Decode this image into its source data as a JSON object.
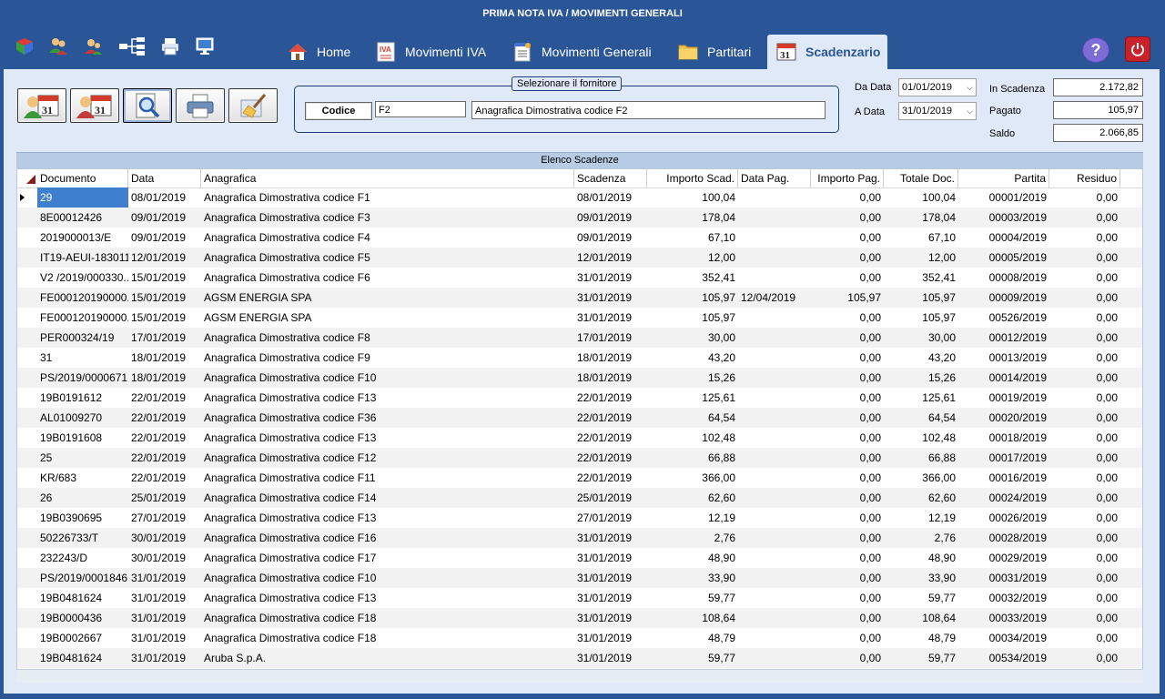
{
  "window": {
    "title": "PRIMA NOTA IVA / MOVIMENTI GENERALI"
  },
  "toolbar_icons": [
    "cube-icon",
    "users-icon",
    "user-icon",
    "tree-icon",
    "printer-icon",
    "monitor-icon"
  ],
  "tabs": [
    {
      "label": "Home",
      "icon": "home-icon"
    },
    {
      "label": "Movimenti IVA",
      "icon": "iva-icon"
    },
    {
      "label": "Movimenti Generali",
      "icon": "notepad-icon"
    },
    {
      "label": "Partitari",
      "icon": "folder-icon"
    },
    {
      "label": "Scadenzario",
      "icon": "calendar-icon",
      "active": true
    }
  ],
  "filter": {
    "legend": "Selezionare il fornitore",
    "codice_button": "Codice",
    "codice_value": "F2",
    "anagrafica_value": "Anagrafica Dimostrativa codice F2"
  },
  "dates": {
    "da_label": "Da Data",
    "da_value": "01/01/2019",
    "a_label": "A Data",
    "a_value": "31/01/2019"
  },
  "summary": {
    "in_scadenza_label": "In Scadenza",
    "in_scadenza_value": "2.172,82",
    "pagato_label": "Pagato",
    "pagato_value": "105,97",
    "saldo_label": "Saldo",
    "saldo_value": "2.066,85"
  },
  "grid": {
    "caption": "Elenco Scadenze",
    "columns": [
      "Documento",
      "Data",
      "Anagrafica",
      "Scadenza",
      "Importo Scad.",
      "Data Pag.",
      "Importo Pag.",
      "Totale Doc.",
      "Partita",
      "Residuo"
    ],
    "rows": [
      [
        "29",
        "08/01/2019",
        "Anagrafica Dimostrativa codice F1",
        "08/01/2019",
        "100,04",
        "",
        "0,00",
        "100,04",
        "00001/2019",
        "0,00"
      ],
      [
        "8E00012426",
        "09/01/2019",
        "Anagrafica Dimostrativa codice F3",
        "09/01/2019",
        "178,04",
        "",
        "0,00",
        "178,04",
        "00003/2019",
        "0,00"
      ],
      [
        "2019000013/E",
        "09/01/2019",
        "Anagrafica Dimostrativa codice F4",
        "09/01/2019",
        "67,10",
        "",
        "0,00",
        "67,10",
        "00004/2019",
        "0,00"
      ],
      [
        "IT19-AEUI-183011",
        "12/01/2019",
        "Anagrafica Dimostrativa codice F5",
        "12/01/2019",
        "12,00",
        "",
        "0,00",
        "12,00",
        "00005/2019",
        "0,00"
      ],
      [
        "V2 /2019/000330...",
        "15/01/2019",
        "Anagrafica Dimostrativa codice F6",
        "31/01/2019",
        "352,41",
        "",
        "0,00",
        "352,41",
        "00008/2019",
        "0,00"
      ],
      [
        "FE000120190000...",
        "15/01/2019",
        "AGSM ENERGIA SPA",
        "31/01/2019",
        "105,97",
        "12/04/2019",
        "105,97",
        "105,97",
        "00009/2019",
        "0,00"
      ],
      [
        "FE000120190000...",
        "15/01/2019",
        "AGSM ENERGIA SPA",
        "31/01/2019",
        "105,97",
        "",
        "0,00",
        "105,97",
        "00526/2019",
        "0,00"
      ],
      [
        "PER000324/19",
        "17/01/2019",
        "Anagrafica Dimostrativa codice F8",
        "17/01/2019",
        "30,00",
        "",
        "0,00",
        "30,00",
        "00012/2019",
        "0,00"
      ],
      [
        "31",
        "18/01/2019",
        "Anagrafica Dimostrativa codice F9",
        "18/01/2019",
        "43,20",
        "",
        "0,00",
        "43,20",
        "00013/2019",
        "0,00"
      ],
      [
        "PS/2019/0000671",
        "18/01/2019",
        "Anagrafica Dimostrativa codice F10",
        "18/01/2019",
        "15,26",
        "",
        "0,00",
        "15,26",
        "00014/2019",
        "0,00"
      ],
      [
        "19B0191612",
        "22/01/2019",
        "Anagrafica Dimostrativa codice F13",
        "22/01/2019",
        "125,61",
        "",
        "0,00",
        "125,61",
        "00019/2019",
        "0,00"
      ],
      [
        "AL01009270",
        "22/01/2019",
        "Anagrafica Dimostrativa codice F36",
        "22/01/2019",
        "64,54",
        "",
        "0,00",
        "64,54",
        "00020/2019",
        "0,00"
      ],
      [
        "19B0191608",
        "22/01/2019",
        "Anagrafica Dimostrativa codice F13",
        "22/01/2019",
        "102,48",
        "",
        "0,00",
        "102,48",
        "00018/2019",
        "0,00"
      ],
      [
        "25",
        "22/01/2019",
        "Anagrafica Dimostrativa codice F12",
        "22/01/2019",
        "66,88",
        "",
        "0,00",
        "66,88",
        "00017/2019",
        "0,00"
      ],
      [
        "KR/683",
        "22/01/2019",
        "Anagrafica Dimostrativa codice F11",
        "22/01/2019",
        "366,00",
        "",
        "0,00",
        "366,00",
        "00016/2019",
        "0,00"
      ],
      [
        "26",
        "25/01/2019",
        "Anagrafica Dimostrativa codice F14",
        "25/01/2019",
        "62,60",
        "",
        "0,00",
        "62,60",
        "00024/2019",
        "0,00"
      ],
      [
        "19B0390695",
        "27/01/2019",
        "Anagrafica Dimostrativa codice F13",
        "27/01/2019",
        "12,19",
        "",
        "0,00",
        "12,19",
        "00026/2019",
        "0,00"
      ],
      [
        "50226733/T",
        "30/01/2019",
        "Anagrafica Dimostrativa codice F16",
        "31/01/2019",
        "2,76",
        "",
        "0,00",
        "2,76",
        "00028/2019",
        "0,00"
      ],
      [
        "232243/D",
        "30/01/2019",
        "Anagrafica Dimostrativa codice F17",
        "31/01/2019",
        "48,90",
        "",
        "0,00",
        "48,90",
        "00029/2019",
        "0,00"
      ],
      [
        "PS/2019/0001846",
        "31/01/2019",
        "Anagrafica Dimostrativa codice F10",
        "31/01/2019",
        "33,90",
        "",
        "0,00",
        "33,90",
        "00031/2019",
        "0,00"
      ],
      [
        "19B0481624",
        "31/01/2019",
        "Anagrafica Dimostrativa codice F13",
        "31/01/2019",
        "59,77",
        "",
        "0,00",
        "59,77",
        "00032/2019",
        "0,00"
      ],
      [
        "19B0000436",
        "31/01/2019",
        "Anagrafica Dimostrativa codice F18",
        "31/01/2019",
        "108,64",
        "",
        "0,00",
        "108,64",
        "00033/2019",
        "0,00"
      ],
      [
        "19B0002667",
        "31/01/2019",
        "Anagrafica Dimostrativa codice F18",
        "31/01/2019",
        "48,79",
        "",
        "0,00",
        "48,79",
        "00034/2019",
        "0,00"
      ],
      [
        "19B0481624",
        "31/01/2019",
        "Aruba S.p.A.",
        "31/01/2019",
        "59,77",
        "",
        "0,00",
        "59,77",
        "00534/2019",
        "0,00"
      ]
    ]
  }
}
